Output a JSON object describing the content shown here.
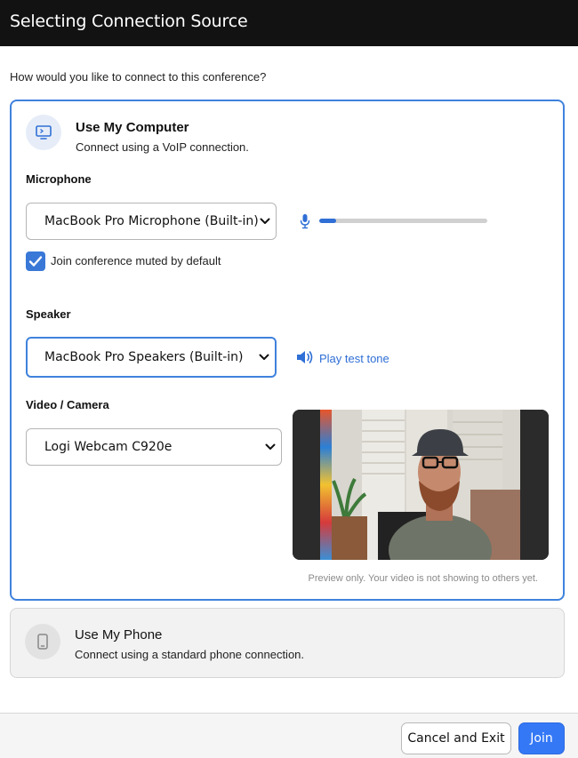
{
  "window": {
    "title": "Selecting Connection Source"
  },
  "prompt": "How would you like to connect to this conference?",
  "computer_option": {
    "title": "Use My Computer",
    "subtitle": "Connect using a VoIP connection.",
    "icon": "monitor-icon",
    "selected": true
  },
  "microphone": {
    "label": "Microphone",
    "selected": "MacBook Pro Microphone (Built-in)",
    "level_fraction": 0.1,
    "muted_checkbox": {
      "label": "Join conference muted by default",
      "checked": true
    }
  },
  "speaker": {
    "label": "Speaker",
    "selected": "MacBook Pro Speakers (Built-in)",
    "test_link": "Play test tone"
  },
  "camera": {
    "label": "Video / Camera",
    "selected": "Logi Webcam C920e",
    "preview_note": "Preview only. Your video is not showing to others yet."
  },
  "phone_option": {
    "title": "Use My Phone",
    "subtitle": "Connect using a standard phone connection.",
    "icon": "phone-icon"
  },
  "footer": {
    "cancel_label": "Cancel and Exit",
    "join_label": "Join"
  },
  "colors": {
    "accent": "#3f82dd",
    "join_button": "#3478f6",
    "titlebar": "#121212"
  }
}
